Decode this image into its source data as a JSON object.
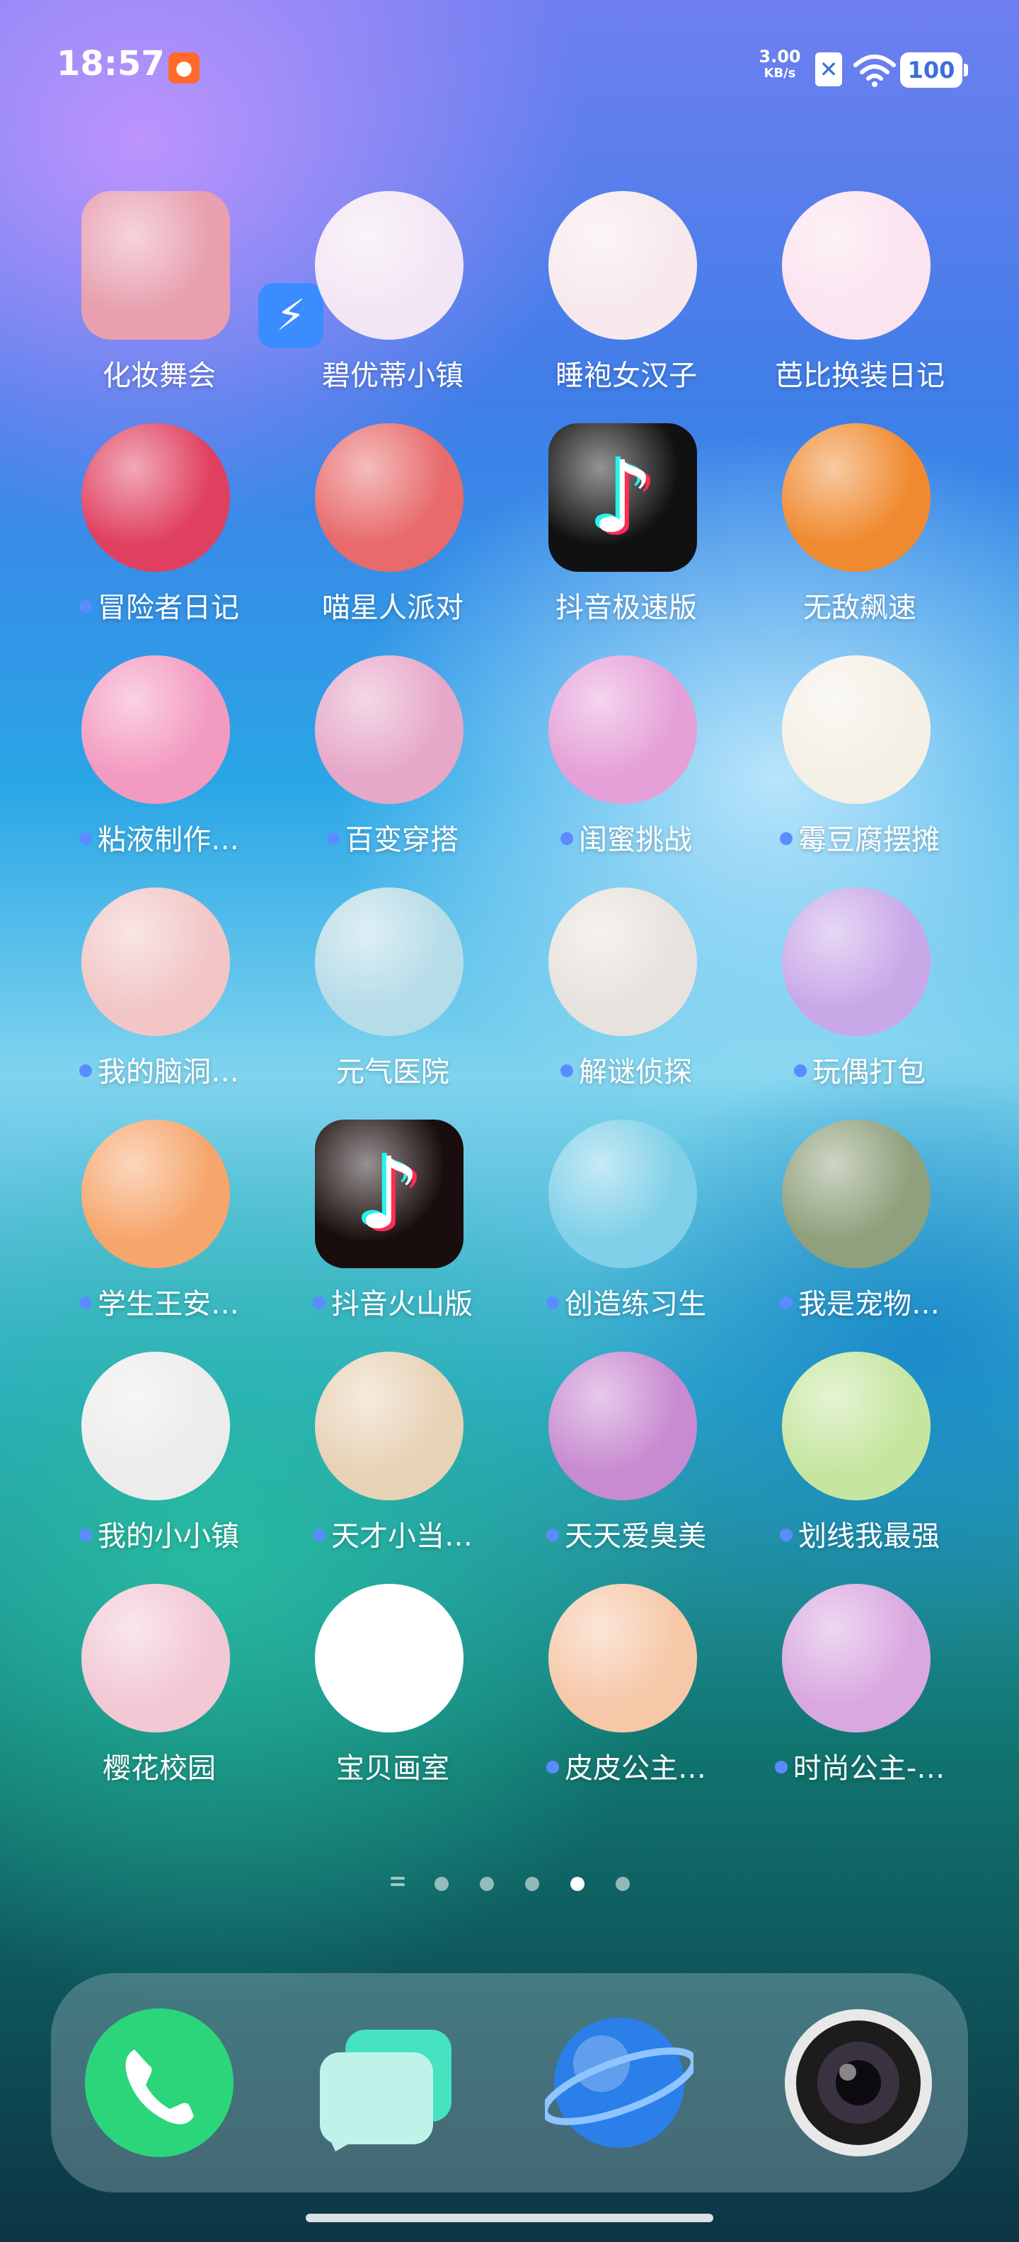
{
  "status_bar": {
    "time": "18:57",
    "notification_icon": "app-notification-icon",
    "net_speed_value": "3.00",
    "net_speed_unit": "KB/s",
    "battery": "100"
  },
  "apps": [
    {
      "label": "化妆舞会",
      "dot": false,
      "icon": "makeup-ball-icon",
      "color": "#e8a0b0"
    },
    {
      "label": "碧优蒂小镇",
      "dot": false,
      "icon": "beauty-town-icon",
      "color": "#f3e6f4"
    },
    {
      "label": "睡袍女汉子",
      "dot": false,
      "icon": "robe-girl-icon",
      "color": "#f7e9ec"
    },
    {
      "label": "芭比换装日记",
      "dot": false,
      "icon": "dressup-diary-icon",
      "color": "#fbe3ef"
    },
    {
      "label": "冒险者日记",
      "dot": true,
      "icon": "adventurer-diary-icon",
      "color": "#e04060"
    },
    {
      "label": "喵星人派对",
      "dot": false,
      "icon": "cat-party-icon",
      "color": "#e86a6a"
    },
    {
      "label": "抖音极速版",
      "dot": false,
      "icon": "douyin-lite-icon",
      "color": "#111111"
    },
    {
      "label": "无敌飙速",
      "dot": false,
      "icon": "invincible-speed-icon",
      "color": "#f08a30"
    },
    {
      "label": "粘液制作…",
      "dot": true,
      "icon": "slime-maker-icon",
      "color": "#f39ac0"
    },
    {
      "label": "百变穿搭",
      "dot": true,
      "icon": "outfit-icon",
      "color": "#e6a8c8"
    },
    {
      "label": "闺蜜挑战",
      "dot": true,
      "icon": "bff-challenge-icon",
      "color": "#e5a0d8"
    },
    {
      "label": "霉豆腐摆摊",
      "dot": true,
      "icon": "tofu-stall-icon",
      "color": "#f4f0e6"
    },
    {
      "label": "我的脑洞…",
      "dot": true,
      "icon": "brain-hole-icon",
      "color": "#f2c6c6"
    },
    {
      "label": "元气医院",
      "dot": false,
      "icon": "hospital-icon",
      "color": "#b6dce8"
    },
    {
      "label": "解谜侦探",
      "dot": true,
      "icon": "puzzle-detective-icon",
      "color": "#e7e2dd"
    },
    {
      "label": "玩偶打包",
      "dot": true,
      "icon": "doll-pack-icon",
      "color": "#c9a8e8"
    },
    {
      "label": "学生王安…",
      "dot": true,
      "icon": "student-icon",
      "color": "#f6a66c"
    },
    {
      "label": "抖音火山版",
      "dot": true,
      "icon": "douyin-volcano-icon",
      "color": "#1a0d0d"
    },
    {
      "label": "创造练习生",
      "dot": true,
      "icon": "trainee-icon",
      "color": "#7fd0e8"
    },
    {
      "label": "我是宠物…",
      "dot": true,
      "icon": "pet-icon",
      "color": "#8fa07c"
    },
    {
      "label": "我的小小镇",
      "dot": true,
      "icon": "little-town-icon",
      "color": "#ececec"
    },
    {
      "label": "天才小当…",
      "dot": true,
      "icon": "genius-boss-icon",
      "color": "#e8d2b6"
    },
    {
      "label": "天天爱臭美",
      "dot": true,
      "icon": "beauty-daily-icon",
      "color": "#c88ad0"
    },
    {
      "label": "划线我最强",
      "dot": true,
      "icon": "draw-line-icon",
      "color": "#c6e6a0"
    },
    {
      "label": "樱花校园",
      "dot": false,
      "icon": "sakura-school-icon",
      "color": "#f2c8d4"
    },
    {
      "label": "宝贝画室",
      "dot": false,
      "icon": "baby-studio-icon",
      "color": "#ffffff"
    },
    {
      "label": "皮皮公主…",
      "dot": true,
      "icon": "pipi-princess-icon",
      "color": "#f6c8a8"
    },
    {
      "label": "时尚公主-…",
      "dot": true,
      "icon": "fashion-princess-icon",
      "color": "#d9a8e0"
    }
  ],
  "page_indicator": {
    "pages": 5,
    "active": 4
  },
  "dock": [
    {
      "name": "phone-icon",
      "color": "#2bd67b"
    },
    {
      "name": "messages-icon",
      "color": "#4fe0c0"
    },
    {
      "name": "browser-icon",
      "color": "#2a7fe8"
    },
    {
      "name": "camera-icon",
      "color": "#222222"
    }
  ]
}
